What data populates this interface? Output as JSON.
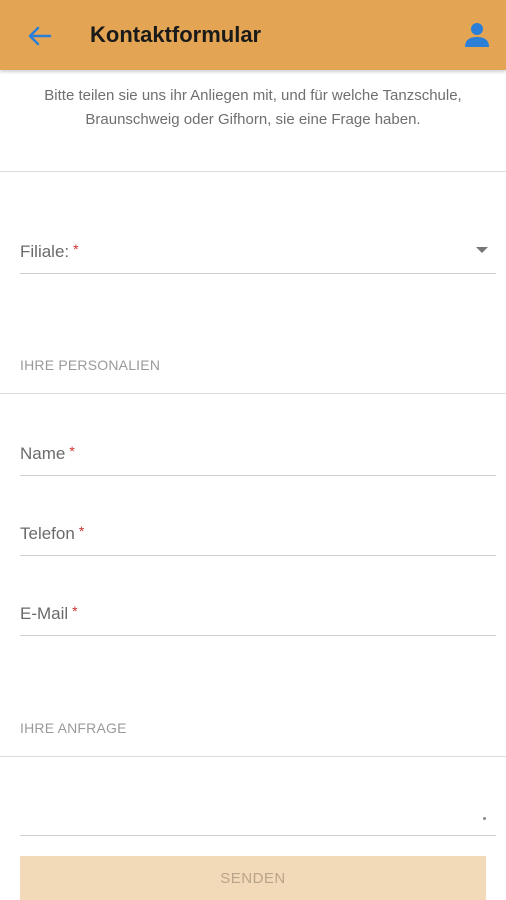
{
  "appbar": {
    "title": "Kontaktformular",
    "back_icon": "arrow-left-icon",
    "account_icon": "user-icon",
    "background": "#e3a553",
    "icon_color": "#2b7fd6"
  },
  "intro": {
    "text": "Bitte teilen sie uns ihr Anliegen mit, und für welche Tanzschule, Braunschweig oder Gifhorn, sie eine Frage haben."
  },
  "form": {
    "branch": {
      "label": "Filiale:",
      "required_marker": "*",
      "icon": "caret-down-icon"
    },
    "section_personal": "IHRE PERSONALIEN",
    "name": {
      "label": "Name",
      "required_marker": "*"
    },
    "phone": {
      "label": "Telefon",
      "required_marker": "*"
    },
    "email": {
      "label": "E-Mail",
      "required_marker": "*"
    },
    "section_request": "IHRE ANFRAGE",
    "request": {
      "value": ""
    },
    "submit_label": "SENDEN"
  },
  "colors": {
    "required": "#d12f2f",
    "submit_bg": "#f2d9b7",
    "submit_text": "#b9a58a"
  }
}
